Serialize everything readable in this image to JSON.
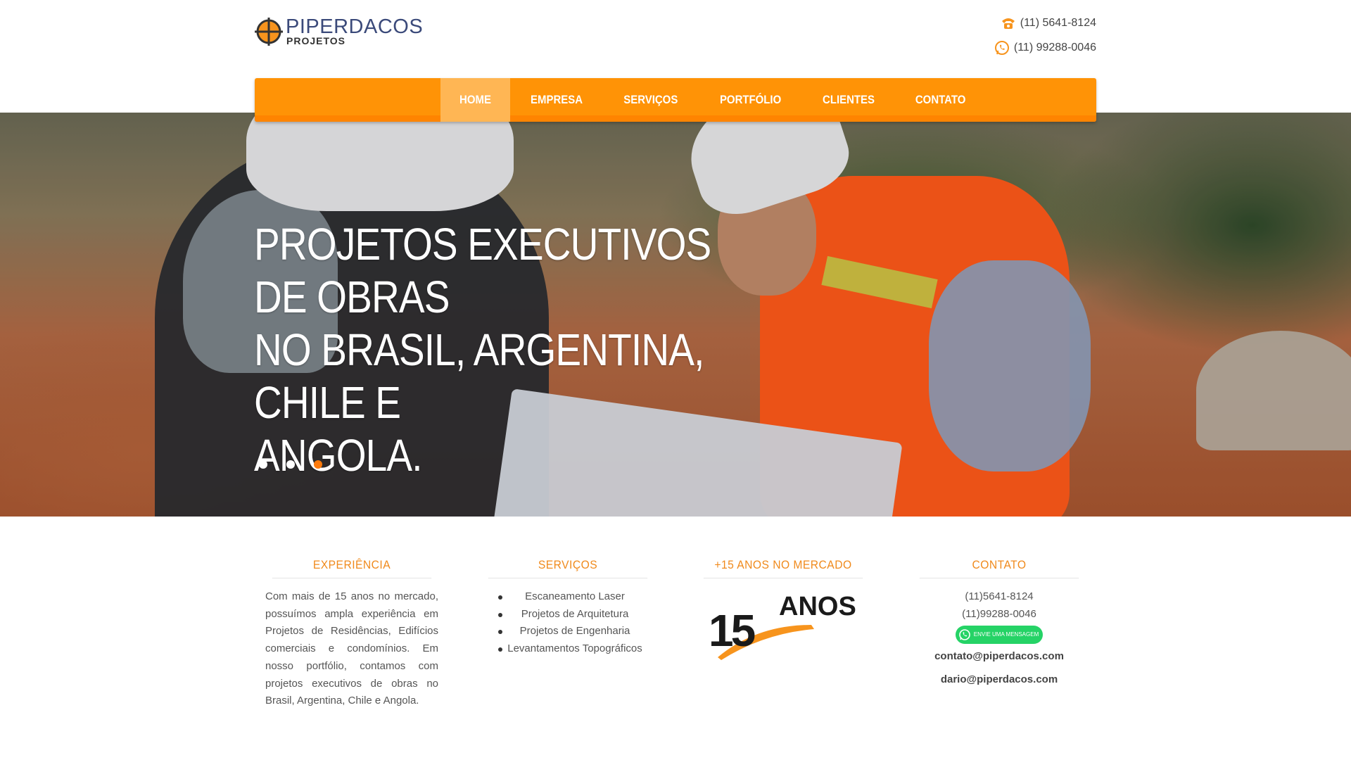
{
  "brand": {
    "name": "PIPERDACOS",
    "sub": "PROJETOS"
  },
  "header": {
    "phone1": "(11) 5641-8124",
    "phone2": "(11) 99288-0046"
  },
  "nav": {
    "items": [
      "HOME",
      "EMPRESA",
      "SERVIÇOS",
      "PORTFÓLIO",
      "CLIENTES",
      "CONTATO"
    ],
    "active": "HOME"
  },
  "hero": {
    "title_line1": "PROJETOS EXECUTIVOS DE OBRAS",
    "title_line2": "NO BRASIL, ARGENTINA, CHILE E",
    "title_line3": "ANGOLA.",
    "slides": 3,
    "active_slide": 3
  },
  "columns": {
    "experiencia": {
      "title": "EXPERIÊNCIA",
      "text": "Com mais de 15 anos no mercado, possuímos ampla experiência em Projetos de Residências, Edifícios comerciais e condomínios. Em nosso portfólio, contamos com projetos executivos de obras no Brasil, Argentina, Chile e Angola."
    },
    "servicos": {
      "title": "SERVIÇOS",
      "items": [
        "Escaneamento Laser",
        "Projetos de Arquitetura",
        "Projetos de Engenharia",
        "Levantamentos Topográficos"
      ]
    },
    "mercado": {
      "title": "+15 ANOS NO MERCADO",
      "badge_number": "15",
      "badge_word": "ANOS"
    },
    "contato": {
      "title": "CONTATO",
      "phone1": "(11)5641-8124",
      "phone2": "(11)99288-0046",
      "whatsapp_label": "ENVIE UMA MENSAGEM",
      "email1": "contato@piperdacos.com",
      "email2": "dario@piperdacos.com"
    }
  },
  "colors": {
    "accent": "#ff9306",
    "active_nav": "#ffb654",
    "whatsapp": "#25d366",
    "title": "#f08a1c"
  }
}
